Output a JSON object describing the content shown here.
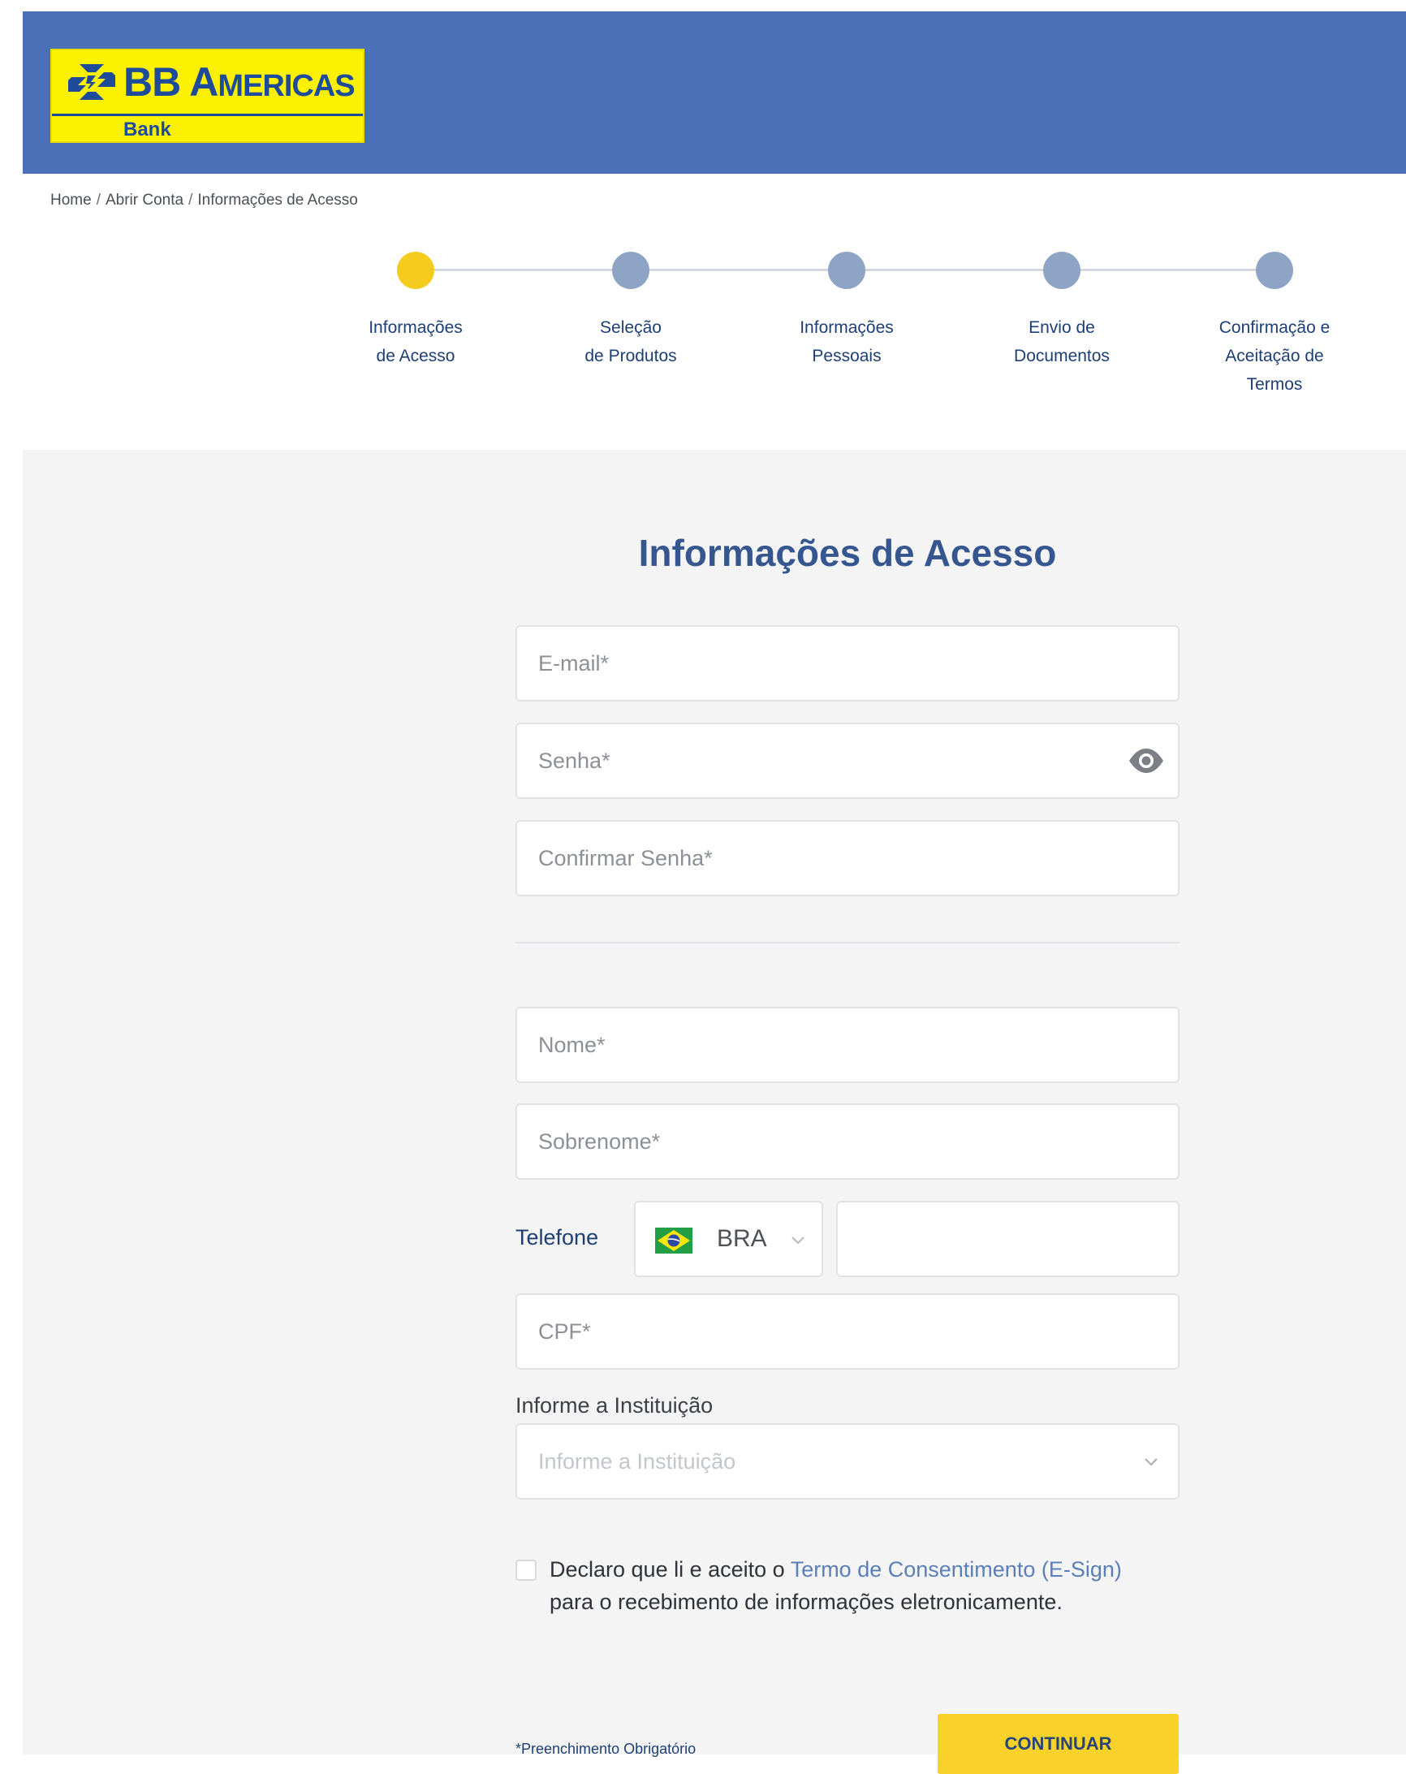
{
  "brand": {
    "name_initial": "BB ",
    "name_big": "A",
    "name_small": "MERICAS",
    "sub": "Bank",
    "yellow": "#fcf003",
    "blue": "#1f4b9b",
    "header_blue": "#4a71b7"
  },
  "breadcrumb": {
    "items": [
      "Home",
      "Abrir Conta",
      "Informações de Acesso"
    ],
    "separator": "/"
  },
  "stepper": {
    "steps": [
      {
        "line1": "Informações",
        "line2": "de Acesso",
        "line3": "",
        "active": true
      },
      {
        "line1": "Seleção",
        "line2": "de Produtos",
        "line3": "",
        "active": false
      },
      {
        "line1": "Informações",
        "line2": "Pessoais",
        "line3": "",
        "active": false
      },
      {
        "line1": "Envio de",
        "line2": "Documentos",
        "line3": "",
        "active": false
      },
      {
        "line1": "Confirmação e",
        "line2": "Aceitação de",
        "line3": "Termos",
        "active": false
      }
    ],
    "active_color": "#f5cc1d",
    "inactive_color": "#8ea4c4"
  },
  "form": {
    "title": "Informações de Acesso",
    "email_placeholder": "E-mail*",
    "password_placeholder": "Senha*",
    "confirm_password_placeholder": "Confirmar Senha*",
    "first_name_placeholder": "Nome*",
    "last_name_placeholder": "Sobrenome*",
    "phone_label": "Telefone",
    "country_code": "BRA",
    "phone_value": "",
    "cpf_placeholder": "CPF*",
    "institution_label": "Informe a Instituição",
    "institution_placeholder": "Informe a Instituição",
    "consent_before": "Declaro que li e aceito o ",
    "consent_link": "Termo de Consentimento (E-Sign)",
    "consent_after": "para o recebimento de informações eletronicamente.",
    "consent_checked": false,
    "required_note": "*Preenchimento Obrigatório",
    "continue_label": "CONTINUAR"
  },
  "icons": {
    "password_toggle": "eye-icon",
    "country_dropdown": "chevron-down-icon",
    "country_flag": "brazil-flag-icon",
    "institution_dropdown": "chevron-down-icon",
    "brand_logo": "bb-logo-icon"
  }
}
